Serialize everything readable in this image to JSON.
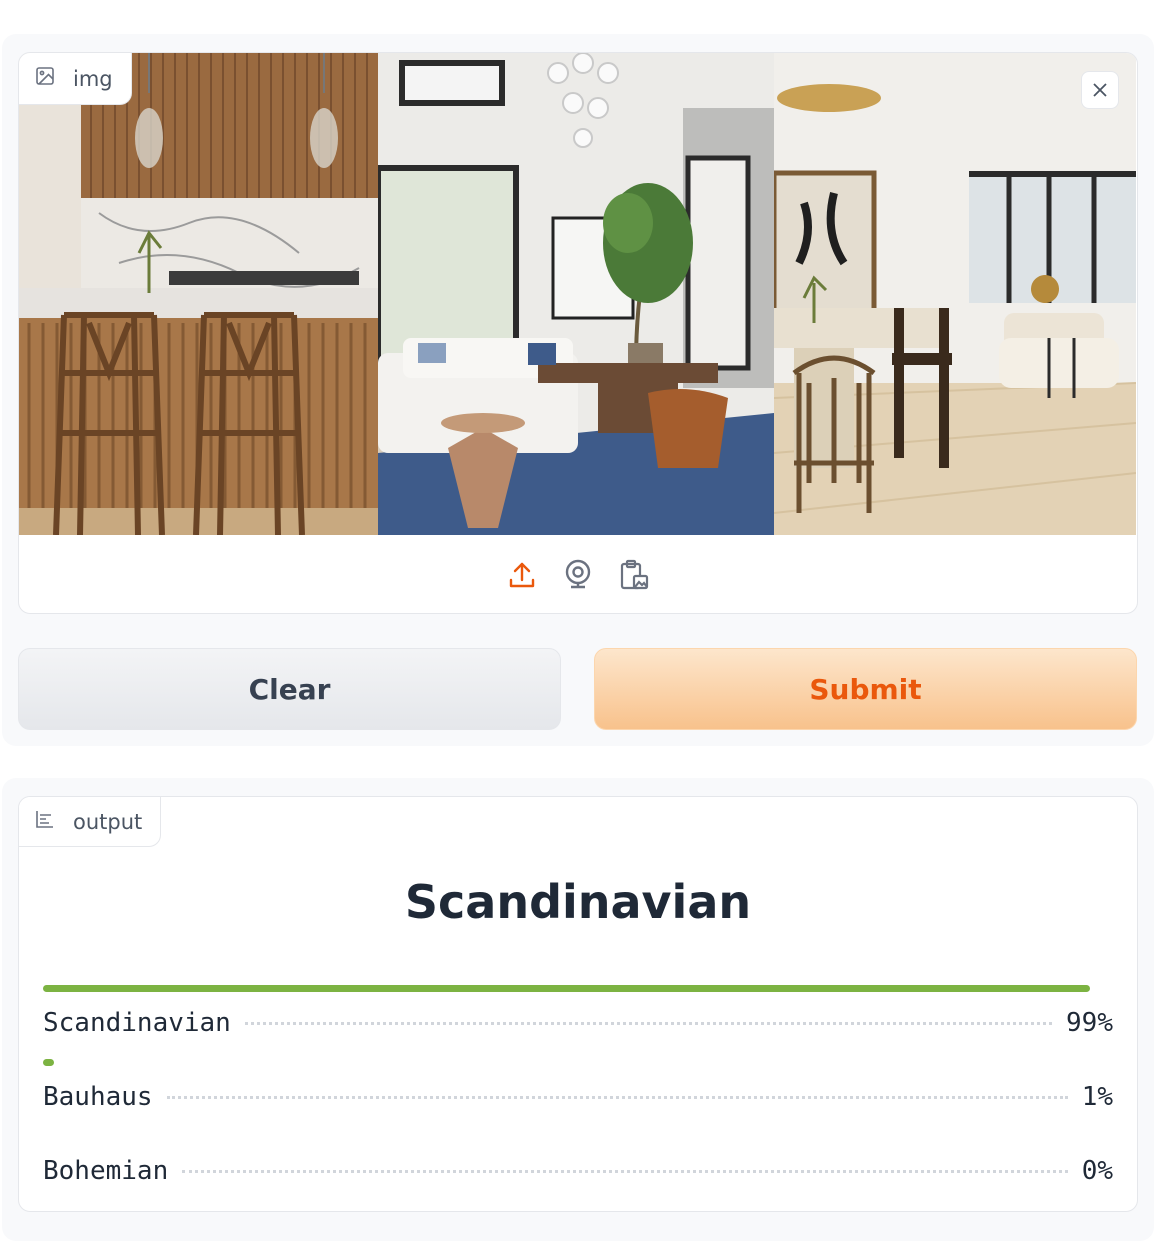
{
  "input": {
    "label": "img",
    "icons": {
      "tab": "image-icon",
      "close": "close-icon",
      "upload": "upload-icon",
      "webcam": "webcam-icon",
      "clipboard": "clipboard-image-icon"
    },
    "clear_label": "Clear",
    "submit_label": "Submit"
  },
  "output": {
    "label": "output",
    "tab_icon": "bar-chart-icon",
    "top_class": "Scandinavian",
    "confidences": [
      {
        "label": "Scandinavian",
        "percent": "99%",
        "fraction": 0.99
      },
      {
        "label": "Bauhaus",
        "percent": "1%",
        "fraction": 0.01
      },
      {
        "label": "Bohemian",
        "percent": "0%",
        "fraction": 0.0
      }
    ]
  },
  "colors": {
    "accent": "#ea580c",
    "bar": "#7cb342"
  }
}
